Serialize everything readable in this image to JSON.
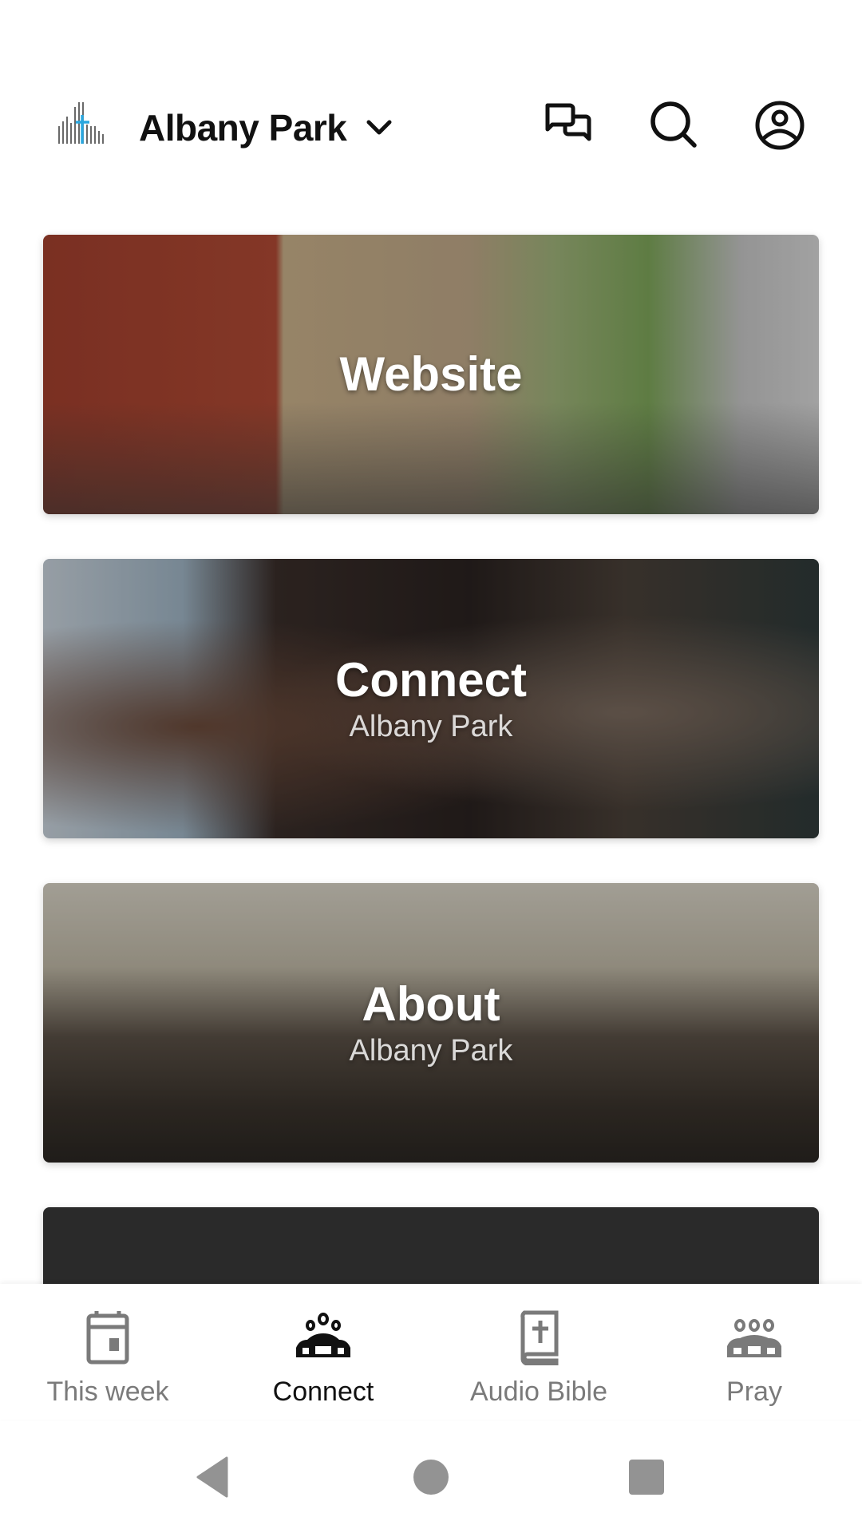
{
  "header": {
    "logo": "church-logo-icon",
    "title": "Albany Park",
    "dropdown_icon": "chevron-down-icon",
    "actions": [
      {
        "name": "chat",
        "icon": "chat-bubbles-icon"
      },
      {
        "name": "search",
        "icon": "search-icon"
      },
      {
        "name": "profile",
        "icon": "account-circle-icon"
      }
    ]
  },
  "cards": [
    {
      "title": "Website",
      "subtitle": ""
    },
    {
      "title": "Connect",
      "subtitle": "Albany Park"
    },
    {
      "title": "About",
      "subtitle": "Albany Park"
    }
  ],
  "bottom_nav": {
    "items": [
      {
        "label": "This week",
        "icon": "calendar-icon",
        "active": false
      },
      {
        "label": "Connect",
        "icon": "groups-icon",
        "active": true
      },
      {
        "label": "Audio Bible",
        "icon": "bible-icon",
        "active": false
      },
      {
        "label": "Pray",
        "icon": "people-icon",
        "active": false
      }
    ]
  },
  "system_nav": {
    "back": "back-icon",
    "home": "home-icon",
    "recents": "recents-icon"
  },
  "colors": {
    "logo_accent": "#2aa7df",
    "active_nav": "#111111",
    "inactive_nav": "#7a7a7a"
  }
}
